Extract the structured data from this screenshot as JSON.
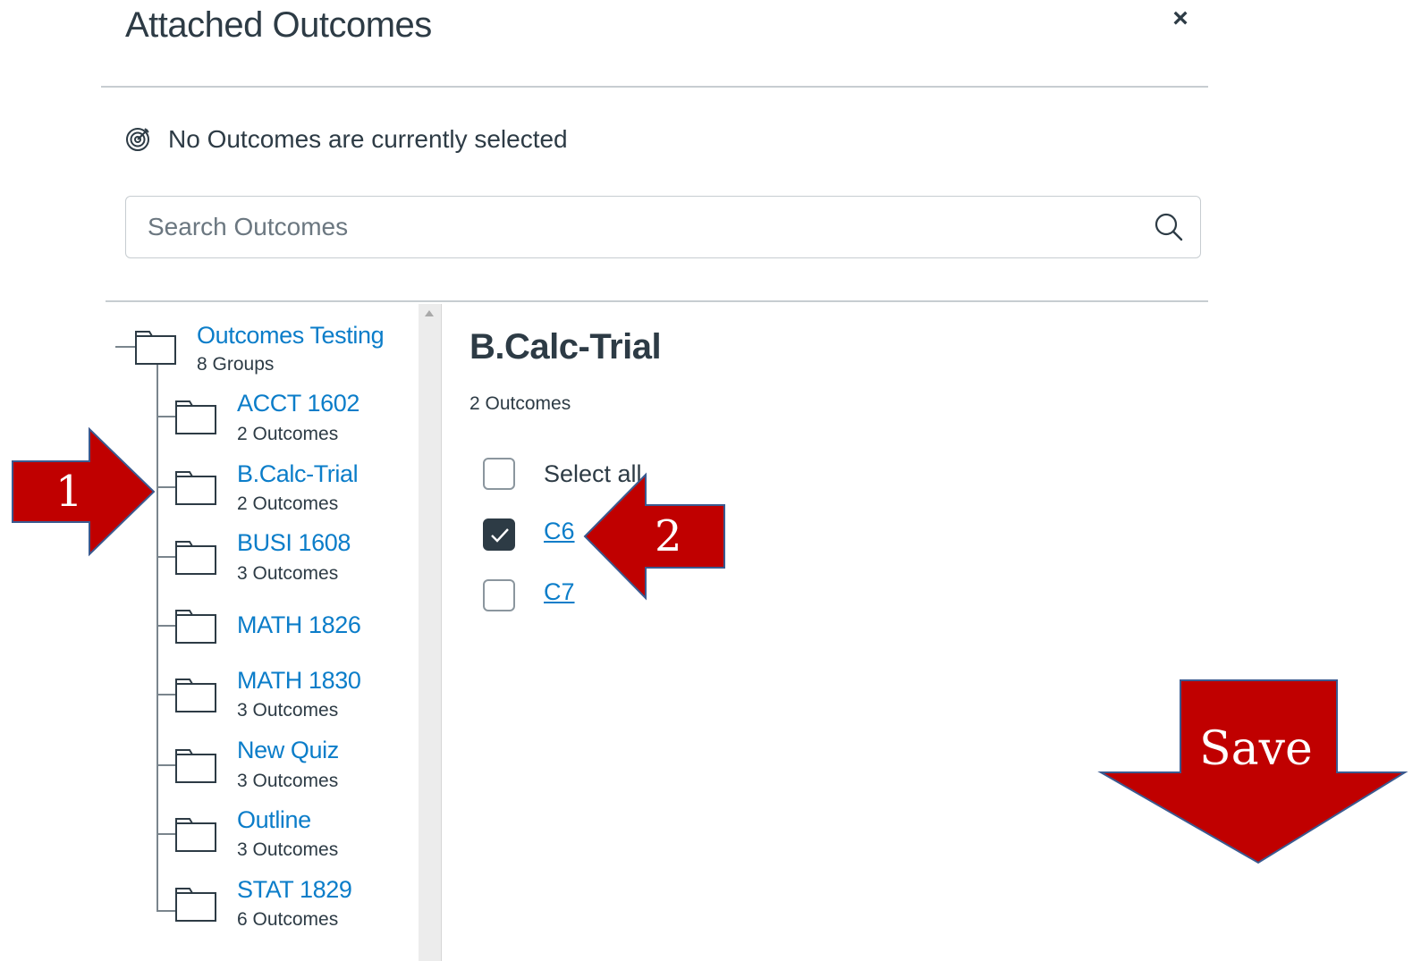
{
  "modal": {
    "title": "Attached Outcomes",
    "close_label": "×"
  },
  "status": {
    "text": "No Outcomes are currently selected"
  },
  "search": {
    "placeholder": "Search Outcomes",
    "value": ""
  },
  "tree": {
    "root": {
      "label": "Outcomes Testing",
      "sub": "8 Groups"
    },
    "groups": [
      {
        "label": "ACCT 1602",
        "sub": "2 Outcomes"
      },
      {
        "label": "B.Calc-Trial",
        "sub": "2 Outcomes"
      },
      {
        "label": "BUSI 1608",
        "sub": "3 Outcomes"
      },
      {
        "label": "MATH 1826",
        "sub": ""
      },
      {
        "label": "MATH 1830",
        "sub": "3 Outcomes"
      },
      {
        "label": "New Quiz",
        "sub": "3 Outcomes"
      },
      {
        "label": "Outline",
        "sub": "3 Outcomes"
      },
      {
        "label": "STAT 1829",
        "sub": "6 Outcomes"
      }
    ]
  },
  "group_panel": {
    "title": "B.Calc-Trial",
    "count": "2 Outcomes",
    "select_all_label": "Select all",
    "outcomes": [
      {
        "label": "C6",
        "checked": true
      },
      {
        "label": "C7",
        "checked": false
      }
    ]
  },
  "annotations": {
    "step1": "1",
    "step2": "2",
    "save": "Save",
    "color": "#c00000"
  },
  "colors": {
    "link": "#0b7dc9",
    "text": "#2d3b45",
    "checkbox_checked": "#2d3b45"
  }
}
